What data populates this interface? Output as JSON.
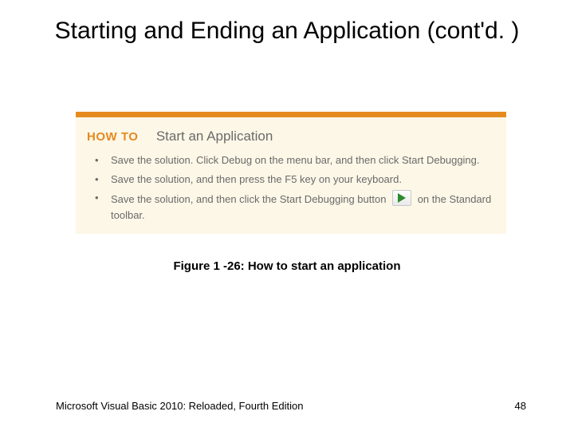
{
  "title": "Starting and Ending an Application (cont'd. )",
  "figure": {
    "howto_label": "HOW TO",
    "howto_title": "Start an Application",
    "bullets": [
      {
        "text_full": "Save the solution. Click Debug on the menu bar, and then click Start Debugging."
      },
      {
        "text_full": "Save the solution, and then press the F5 key on your keyboard."
      },
      {
        "pre": "Save the solution, and then click the Start Debugging button",
        "post": "on the Standard toolbar."
      }
    ]
  },
  "caption": "Figure 1 -26: How to start an application",
  "footer": {
    "left": "Microsoft Visual Basic 2010: Reloaded, Fourth Edition",
    "page": "48"
  }
}
